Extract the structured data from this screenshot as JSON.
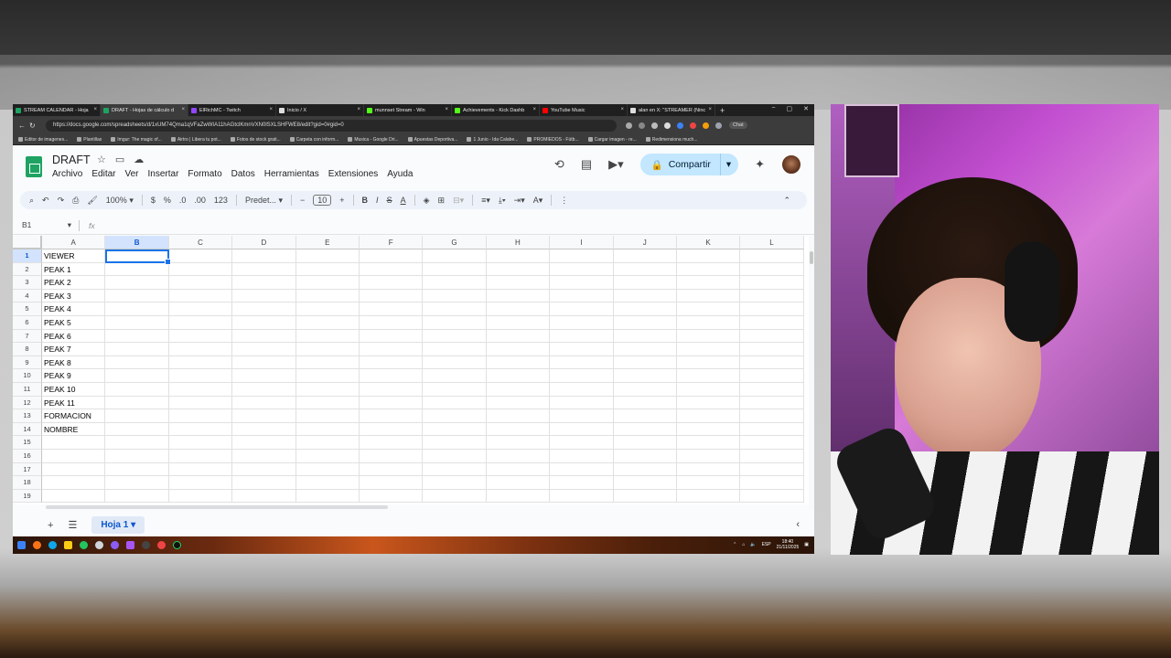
{
  "browser": {
    "tabs": [
      {
        "label": "STREAM CALENDAR - Hoja",
        "color": "#1ea362"
      },
      {
        "label": "DRAFT - Hojas de cálculo d",
        "color": "#1ea362",
        "active": true
      },
      {
        "label": "ElRichMC - Twitch",
        "color": "#9146ff"
      },
      {
        "label": "Inicio / X",
        "color": "#dddddd"
      },
      {
        "label": "munnset Stream - Win",
        "color": "#53fc18"
      },
      {
        "label": "Achievements - Kick Dashb",
        "color": "#53fc18"
      },
      {
        "label": "YouTube Music",
        "color": "#ff0000"
      },
      {
        "label": "alan en X: \"STREAMER (Ninc",
        "color": "#dddddd"
      }
    ],
    "url": "https://docs.google.com/spreadsheets/d/1xUM74Qma1qVFaZwWIA11hAGtclKmnVXN0lSXLSHFWE8/edit?gid=0#gid=0",
    "chat_label": "Chat",
    "bookmarks": [
      "Editor de imagenes...",
      "Plantillas",
      "Imgur: The magic of...",
      "Airtro | Libera tu pot...",
      "Fotos de stock grati...",
      "Carpeta con inform...",
      "Musica - Google Dri...",
      "Apuestas Deportiva...",
      "1 Junio - Ida Calabe...",
      "PROMIEDOS - Fútb...",
      "Cargar imagen - re...",
      "Redimensiona much..."
    ]
  },
  "sheets": {
    "title": "DRAFT",
    "menus": [
      "Archivo",
      "Editar",
      "Ver",
      "Insertar",
      "Formato",
      "Datos",
      "Herramientas",
      "Extensiones",
      "Ayuda"
    ],
    "share_label": "Compartir",
    "toolbar": {
      "zoom": "100%",
      "currency": "$",
      "percent": "%",
      "dec_decrease": ".0",
      "dec_increase": ".00",
      "number_format": "123",
      "font": "Predet...",
      "font_size": "10"
    },
    "name_box": "B1",
    "fx_label": "fx",
    "columns": [
      "A",
      "B",
      "C",
      "D",
      "E",
      "F",
      "G",
      "H",
      "I",
      "J",
      "K",
      "L"
    ],
    "selected_column": "B",
    "rows": [
      {
        "num": "1",
        "a": "VIEWER"
      },
      {
        "num": "2",
        "a": "PEAK 1"
      },
      {
        "num": "3",
        "a": "PEAK 2"
      },
      {
        "num": "4",
        "a": "PEAK 3"
      },
      {
        "num": "5",
        "a": "PEAK 4"
      },
      {
        "num": "6",
        "a": "PEAK 5"
      },
      {
        "num": "7",
        "a": "PEAK 6"
      },
      {
        "num": "8",
        "a": "PEAK 7"
      },
      {
        "num": "9",
        "a": "PEAK 8"
      },
      {
        "num": "10",
        "a": "PEAK 9"
      },
      {
        "num": "11",
        "a": "PEAK 10"
      },
      {
        "num": "12",
        "a": "PEAK 11"
      },
      {
        "num": "13",
        "a": "FORMACION"
      },
      {
        "num": "14",
        "a": "NOMBRE"
      },
      {
        "num": "15",
        "a": ""
      },
      {
        "num": "16",
        "a": ""
      },
      {
        "num": "17",
        "a": ""
      },
      {
        "num": "18",
        "a": ""
      },
      {
        "num": "19",
        "a": ""
      }
    ],
    "sheet_tab": "Hoja 1"
  },
  "taskbar": {
    "lang": "ESP",
    "time": "18:40",
    "date": "21/11/2025"
  }
}
